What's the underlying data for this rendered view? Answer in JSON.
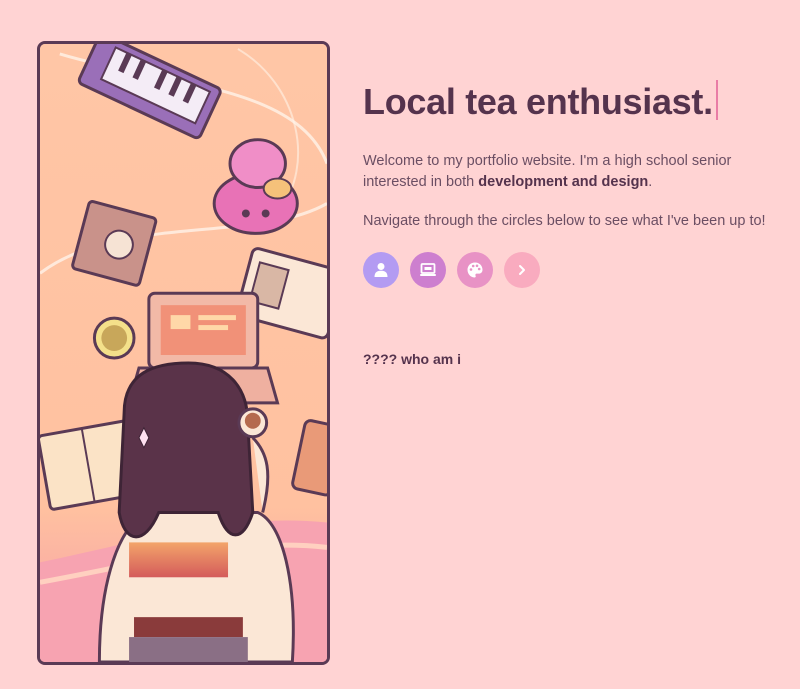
{
  "header": {
    "headline": "Local tea enthusiast."
  },
  "intro": {
    "line_before_bold": "Welcome to my portfolio website. I'm a high school senior interested in both ",
    "bold_text": "development and design",
    "line_after_bold": "."
  },
  "nav_hint": "Navigate through the circles below to see what I've been up to!",
  "nav_circles": [
    {
      "icon": "user-icon",
      "color": "#b39bf2"
    },
    {
      "icon": "laptop-icon",
      "color": "#cd7fcf"
    },
    {
      "icon": "palette-icon",
      "color": "#e892c5"
    },
    {
      "icon": "chevron-right-icon",
      "color": "#f9abbf"
    }
  ],
  "section": {
    "label": "???? who am i"
  },
  "colors": {
    "background": "#ffd3d3",
    "heading": "#55334d",
    "cursor": "#e97da6"
  }
}
